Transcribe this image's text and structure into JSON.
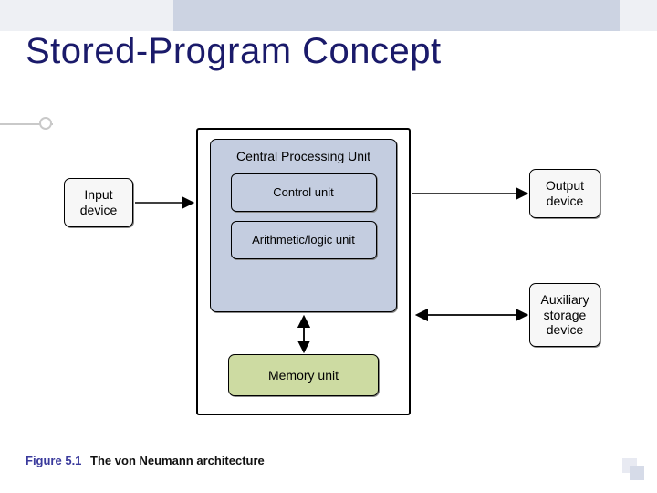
{
  "title": "Stored-Program Concept",
  "caption": {
    "num": "Figure 5.1",
    "text": "The von Neumann architecture"
  },
  "boxes": {
    "input": "Input\ndevice",
    "output": "Output\ndevice",
    "aux": "Auxiliary\nstorage\ndevice",
    "cpu": "Central Processing Unit",
    "control": "Control unit",
    "alu": "Arithmetic/logic unit",
    "memory": "Memory unit"
  }
}
